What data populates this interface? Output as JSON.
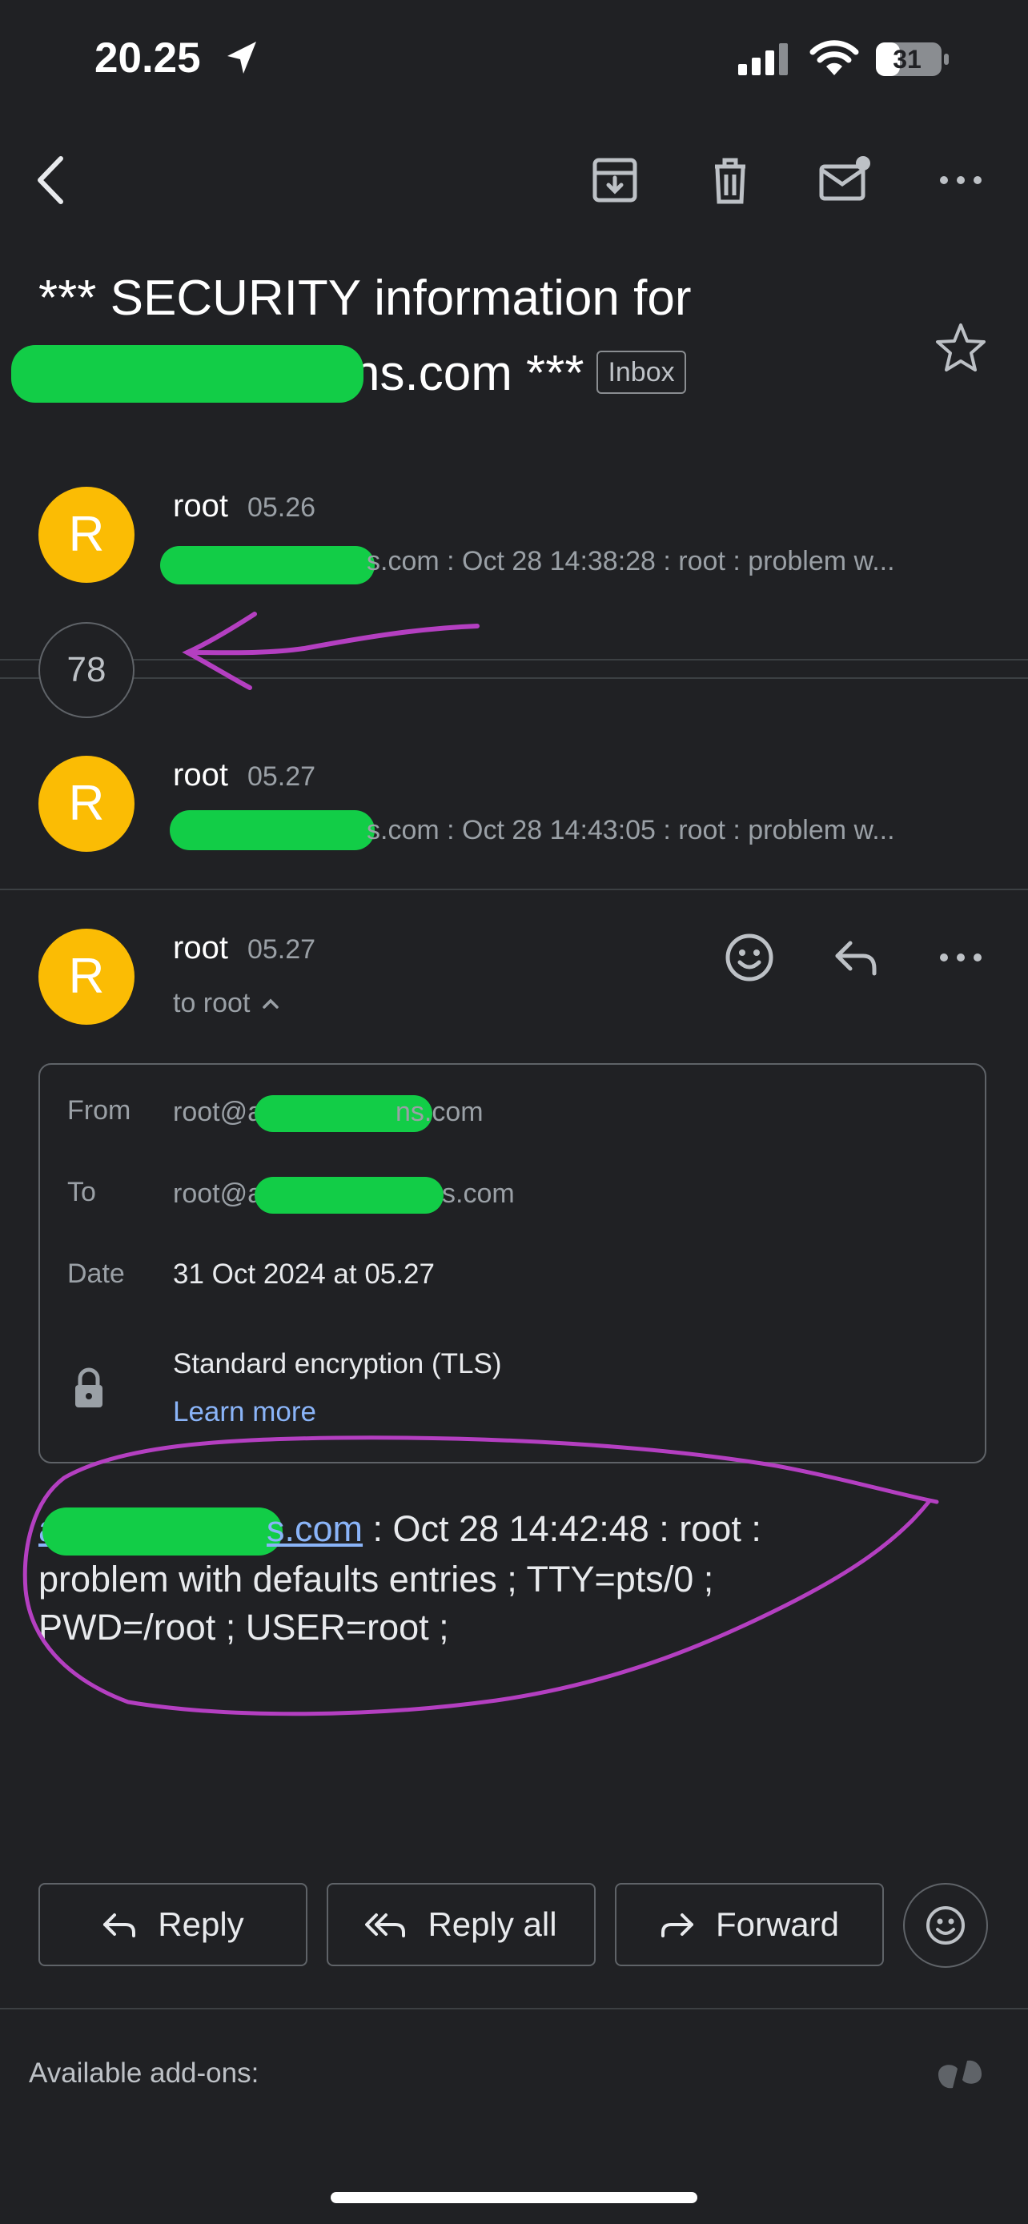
{
  "status_bar": {
    "time": "20.25",
    "battery": "31"
  },
  "toolbar": {
    "back": "back-arrow-icon",
    "archive": "archive-icon",
    "delete": "trash-icon",
    "mark_unread": "mark-unread-icon",
    "more": "more-icon"
  },
  "email": {
    "subject_line1": "*** SECURITY information for",
    "subject_line2_suffix": "ns.com ***",
    "label": "Inbox"
  },
  "thread": {
    "messages": [
      {
        "avatar": "R",
        "sender": "root",
        "time": "05.26",
        "snippet": "s.com : Oct 28 14:38:28 : root : problem w..."
      },
      {
        "avatar": "R",
        "sender": "root",
        "time": "05.27",
        "snippet": "s.com : Oct 28 14:43:05 : root : problem w..."
      }
    ],
    "collapsed_count": "78",
    "open_message": {
      "avatar": "R",
      "sender": "root",
      "time": "05.27",
      "recipient": "to root"
    }
  },
  "details": {
    "from_label": "From",
    "from_prefix": "root@a",
    "from_suffix": "ns.com",
    "to_label": "To",
    "to_prefix": "root@a",
    "to_suffix": "s.com",
    "date_label": "Date",
    "date_value": "31 Oct 2024 at 05.27",
    "encryption": "Standard encryption (TLS)",
    "learn_more": "Learn more"
  },
  "body": {
    "link_prefix": "a",
    "link_suffix": "s.com",
    "line1_rest": " : Oct 28 14:42:48 : root :",
    "line2": "problem with defaults entries ; TTY=pts/0 ;",
    "line3": "PWD=/root ; USER=root ;"
  },
  "actions": {
    "reply": "Reply",
    "reply_all": "Reply all",
    "forward": "Forward"
  },
  "footer": {
    "addons": "Available add-ons:"
  },
  "colors": {
    "background": "#202124",
    "avatar": "#fbbc04",
    "redaction": "#12cd47",
    "annotation": "#b43fc1",
    "link": "#8ab4f8"
  }
}
